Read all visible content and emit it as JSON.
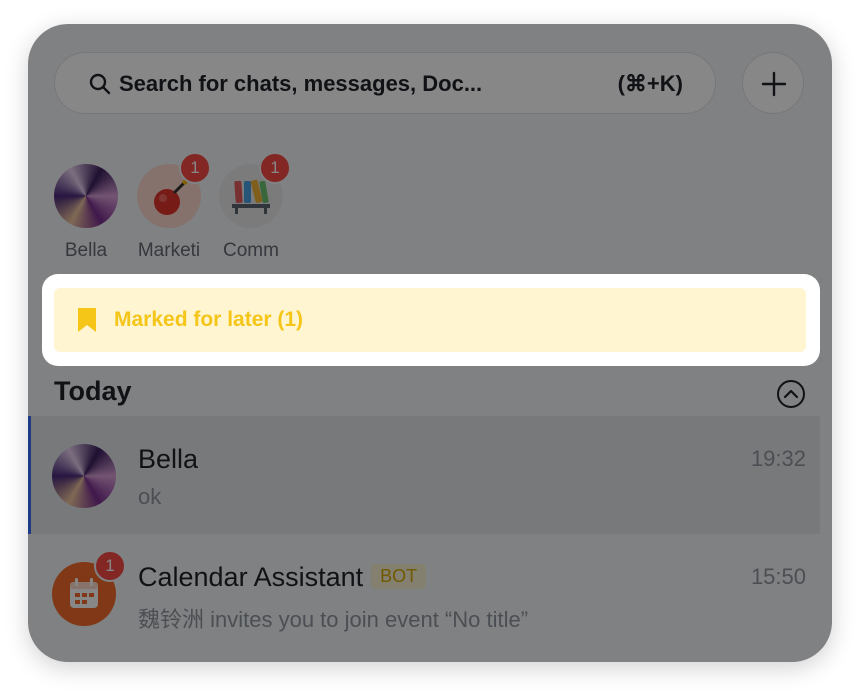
{
  "search": {
    "placeholder": "Search for chats, messages, Doc...",
    "shortcut": "(⌘+K)"
  },
  "quick_access": [
    {
      "label": "Bella",
      "badge": ""
    },
    {
      "label": "Marketi",
      "badge": "1"
    },
    {
      "label": "Comm",
      "badge": "1"
    }
  ],
  "marked_for_later": {
    "label": "Marked for later (1)"
  },
  "sections": {
    "today": "Today"
  },
  "chats": [
    {
      "name": "Bella",
      "preview": "ok",
      "time": "19:32"
    },
    {
      "name": "Calendar Assistant",
      "tag": "BOT",
      "preview": "魏铃洲 invites you to join event “No title”",
      "time": "15:50",
      "badge": "1"
    }
  ],
  "colors": {
    "accent": "#3370ff",
    "badge": "#f54a45",
    "marked": "#f5c518",
    "calendar": "#f26a2a"
  }
}
